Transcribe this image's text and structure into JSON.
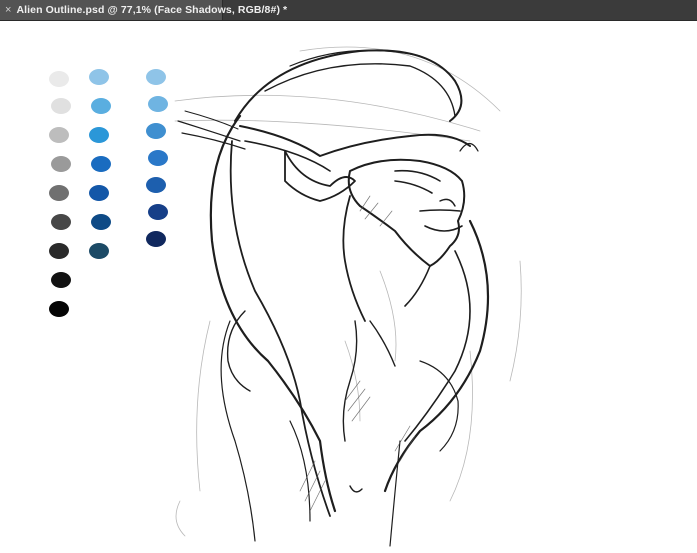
{
  "document_tab": {
    "close_glyph": "×",
    "title": "Alien Outline.psd @ 77,1% (Face Shadows, RGB/8#) *"
  },
  "palette": {
    "grays": [
      "#eaeaea",
      "#e0e0e0",
      "#bdbdbd",
      "#9a9a9a",
      "#707070",
      "#474747",
      "#2a2a2a",
      "#121212",
      "#050505"
    ],
    "blues_mid": [
      "#8fc4e8",
      "#5aaee0",
      "#2b97d8",
      "#1a6cc0",
      "#1357a8",
      "#0e4a86",
      "#1c4a66"
    ],
    "blues_right": [
      "#8fc4e8",
      "#6fb4e2",
      "#3f8fd0",
      "#2a78c8",
      "#1d5fae",
      "#163f88",
      "#10285e"
    ]
  }
}
